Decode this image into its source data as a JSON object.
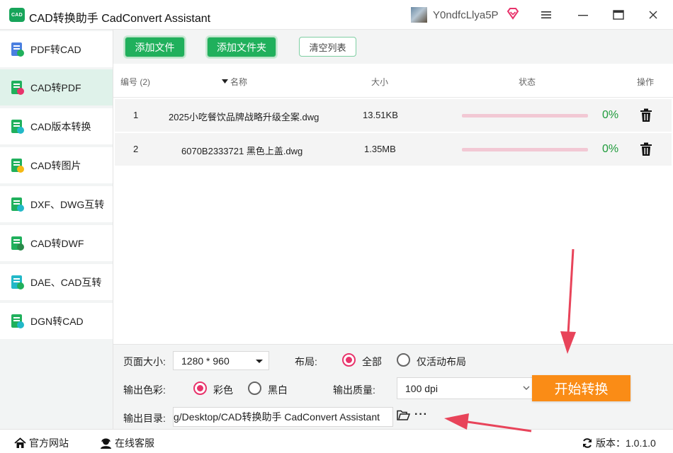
{
  "app": {
    "logo_text": "CAD",
    "title": "CAD转换助手 CadConvert Assistant",
    "user_name": "Y0ndfcLlya5P"
  },
  "sidebar": {
    "items": [
      {
        "label": "PDF转CAD",
        "active": false
      },
      {
        "label": "CAD转PDF",
        "active": true
      },
      {
        "label": "CAD版本转换",
        "active": false
      },
      {
        "label": "CAD转图片",
        "active": false
      },
      {
        "label": "DXF、DWG互转",
        "active": false
      },
      {
        "label": "CAD转DWF",
        "active": false
      },
      {
        "label": "DAE、CAD互转",
        "active": false
      },
      {
        "label": "DGN转CAD",
        "active": false
      }
    ]
  },
  "toolbar": {
    "add_file": "添加文件",
    "add_folder": "添加文件夹",
    "clear_list": "清空列表"
  },
  "table": {
    "headers": {
      "index": "编号 (2)",
      "name": "名称",
      "size": "大小",
      "status": "状态",
      "action": "操作"
    },
    "rows": [
      {
        "index": "1",
        "name": "2025小吃餐饮品牌战略升级全案.dwg",
        "size": "13.51KB",
        "progress": 0,
        "progress_text": "0%"
      },
      {
        "index": "2",
        "name": "6070B2333721 黑色上盖.dwg",
        "size": "1.35MB",
        "progress": 0,
        "progress_text": "0%"
      }
    ]
  },
  "options": {
    "page_size_label": "页面大小:",
    "page_size_value": "1280 * 960",
    "layout_label": "布局:",
    "layout_all": "全部",
    "layout_active_only": "仅活动布局",
    "color_label": "输出色彩:",
    "color_color": "彩色",
    "color_bw": "黑白",
    "quality_label": "输出质量:",
    "quality_value": "100 dpi",
    "output_dir_label": "输出目录:",
    "output_dir_value": "g/Desktop/CAD转换助手 CadConvert Assistant",
    "more_symbol": "···",
    "start_button": "开始转换"
  },
  "statusbar": {
    "website": "官方网站",
    "support": "在线客服",
    "version": "版本：1.0.1.0"
  },
  "colors": {
    "accent_green": "#20b05c",
    "start_orange": "#fa8c16",
    "radio_selected": "#e8336b",
    "annotation_arrow": "#e8445a"
  }
}
